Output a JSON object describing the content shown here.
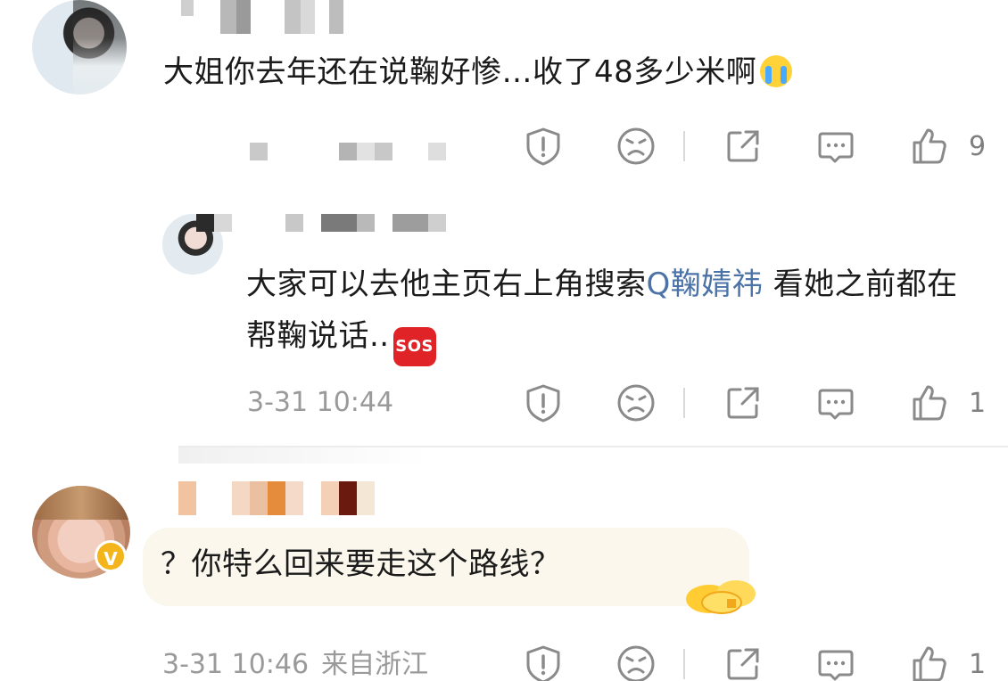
{
  "comments": [
    {
      "text": "大姐你去年还在说鞠好惨…收了48多少米啊",
      "emoji": "crying-face",
      "like_count": "9"
    },
    {
      "text_before": "大家可以去他主页右上角搜索",
      "search_link": "Q鞠婧祎",
      "text_after": " 看她之前都在帮鞠说话..",
      "emoji_label": "SOS",
      "timestamp": "3-31 10:44",
      "like_count": "1"
    },
    {
      "text": "？你特么回来要走这个路线？",
      "timestamp": "3-31 10:46",
      "location": "来自浙江",
      "like_count": "1"
    }
  ],
  "colors": {
    "link": "#4b73a8",
    "meta": "#9a9a9a",
    "icon": "#8a8a8a",
    "verified_badge": "#f3b51b",
    "sos_bg": "#e02326",
    "bubble_bg": "#fbf7ec"
  },
  "icons": [
    "report-icon",
    "dislike-face-icon",
    "share-icon",
    "comment-icon",
    "like-thumb-icon",
    "verified-badge-icon"
  ]
}
